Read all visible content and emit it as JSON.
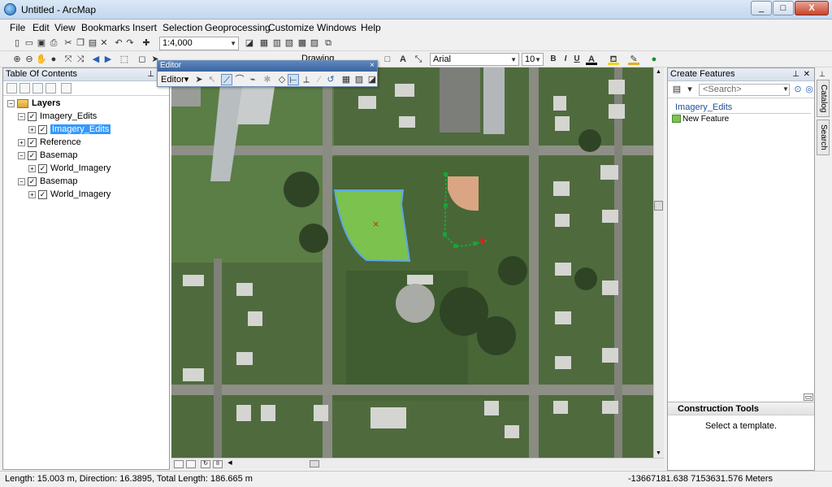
{
  "window": {
    "title": "Untitled - ArcMap",
    "minimize": "_",
    "maximize": "□",
    "close": "X"
  },
  "menu": [
    "File",
    "Edit",
    "View",
    "Bookmarks",
    "Insert",
    "Selection",
    "Geoprocessing",
    "Customize",
    "Windows",
    "Help"
  ],
  "standard_toolbar": {
    "scale": "1:4,000"
  },
  "draw_toolbar": {
    "label": "Drawing",
    "font_name": "Arial",
    "font_size": "10",
    "bold": "B",
    "italic": "I",
    "underline": "U",
    "text_tool": "A"
  },
  "toc": {
    "title": "Table Of Contents",
    "layers": [
      {
        "label": "Layers",
        "level": 0,
        "expand": "−",
        "checked": null,
        "selected": false
      },
      {
        "label": "Imagery_Edits",
        "level": 1,
        "expand": "−",
        "checked": true,
        "selected": false
      },
      {
        "label": "Imagery_Edits",
        "level": 2,
        "expand": "+",
        "checked": true,
        "selected": true
      },
      {
        "label": "Reference",
        "level": 1,
        "expand": "+",
        "checked": true,
        "selected": false
      },
      {
        "label": "Basemap",
        "level": 1,
        "expand": "−",
        "checked": true,
        "selected": false
      },
      {
        "label": "World_Imagery",
        "level": 2,
        "expand": "+",
        "checked": true,
        "selected": false
      },
      {
        "label": "Basemap",
        "level": 1,
        "expand": "−",
        "checked": true,
        "selected": false
      },
      {
        "label": "World_Imagery",
        "level": 2,
        "expand": "+",
        "checked": true,
        "selected": false
      }
    ]
  },
  "editor": {
    "title": "Editor",
    "menu": "Editor▾",
    "close": "×"
  },
  "create_features": {
    "title": "Create Features",
    "search_placeholder": "<Search>",
    "group": "Imagery_Edits",
    "template": "New Feature",
    "construction_title": "Construction Tools",
    "construction_hint": "Select a template."
  },
  "side_tabs": [
    "Catalog",
    "Search"
  ],
  "status": {
    "measure": "Length: 15.003 m, Direction: 16.3895, Total Length: 186.665 m",
    "coords": "-13667181.638  7153631.576 Meters"
  },
  "colors": {
    "polygon_fill": "#7cc24e",
    "polygon_outline": "#5aa8e6",
    "sketch_line": "#1aa33a",
    "sketch_end": "#e02020",
    "selection": "#3399ff"
  }
}
